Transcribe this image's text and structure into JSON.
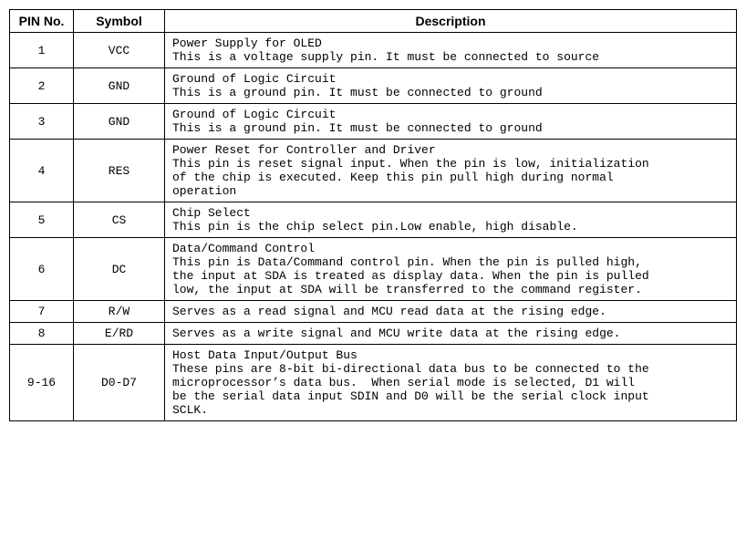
{
  "table": {
    "headers": [
      "PIN No.",
      "Symbol",
      "Description"
    ],
    "rows": [
      {
        "pin": "1",
        "symbol": "VCC",
        "desc_title": "Power Supply for OLED",
        "desc_body": "This is a voltage supply pin. It must be connected to source"
      },
      {
        "pin": "2",
        "symbol": "GND",
        "desc_title": "Ground of Logic Circuit",
        "desc_body": "This is a ground pin. It must be connected to ground"
      },
      {
        "pin": "3",
        "symbol": "GND",
        "desc_title": "Ground of Logic Circuit",
        "desc_body": "This is a ground pin. It must be connected to ground"
      },
      {
        "pin": "4",
        "symbol": "RES",
        "desc_title": "Power Reset for Controller and Driver",
        "desc_body": "This pin is reset signal input. When the pin is low, initialization\nof the chip is executed. Keep this pin pull high during normal\noperation"
      },
      {
        "pin": "5",
        "symbol": "CS",
        "desc_title": "Chip Select",
        "desc_body": "This pin is the chip select pin.Low enable, high disable."
      },
      {
        "pin": "6",
        "symbol": "DC",
        "desc_title": "Data/Command Control",
        "desc_body": "This pin is Data/Command control pin. When the pin is pulled high,\nthe input at SDA is treated as display data. When the pin is pulled\nlow, the input at SDA will be transferred to the command register."
      },
      {
        "pin": "7",
        "symbol": "R/W",
        "desc_title": "",
        "desc_body": "Serves as a read signal and MCU read data at the rising edge."
      },
      {
        "pin": "8",
        "symbol": "E/RD",
        "desc_title": "",
        "desc_body": "Serves as a write signal and MCU write data at the rising edge."
      },
      {
        "pin": "9-16",
        "symbol": "D0-D7",
        "desc_title": "Host Data Input/Output Bus",
        "desc_body": "These pins are 8-bit bi-directional data bus to be connected to the\nmicroprocessor’s data bus.  When serial mode is selected, D1 will\nbe the serial data input SDIN and D0 will be the serial clock input\nSCLK."
      }
    ]
  }
}
